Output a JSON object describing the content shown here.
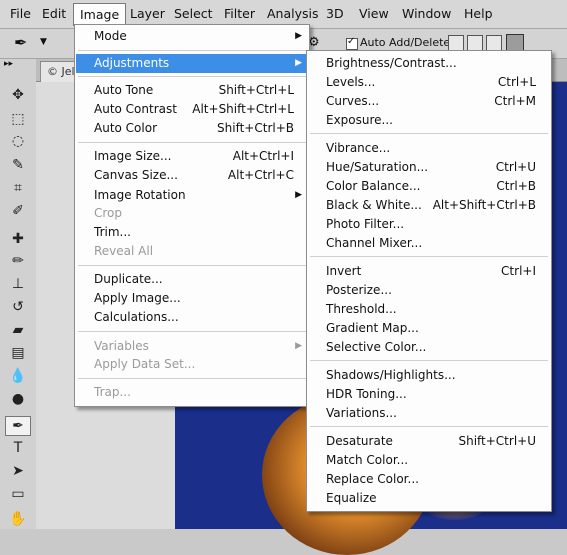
{
  "menubar": {
    "items": [
      "File",
      "Edit",
      "Image",
      "Layer",
      "Select",
      "Filter",
      "Analysis",
      "3D",
      "View",
      "Window",
      "Help"
    ]
  },
  "options": {
    "auto_add_delete": "Auto Add/Delete"
  },
  "document": {
    "tab": "© Jel"
  },
  "image_menu": {
    "mode": "Mode",
    "adjustments": "Adjustments",
    "auto_tone": {
      "label": "Auto Tone",
      "shortcut": "Shift+Ctrl+L"
    },
    "auto_contrast": {
      "label": "Auto Contrast",
      "shortcut": "Alt+Shift+Ctrl+L"
    },
    "auto_color": {
      "label": "Auto Color",
      "shortcut": "Shift+Ctrl+B"
    },
    "image_size": {
      "label": "Image Size...",
      "shortcut": "Alt+Ctrl+I"
    },
    "canvas_size": {
      "label": "Canvas Size...",
      "shortcut": "Alt+Ctrl+C"
    },
    "image_rotation": "Image Rotation",
    "crop": "Crop",
    "trim": "Trim...",
    "reveal_all": "Reveal All",
    "duplicate": "Duplicate...",
    "apply_image": "Apply Image...",
    "calculations": "Calculations...",
    "variables": "Variables",
    "apply_data_set": "Apply Data Set...",
    "trap": "Trap..."
  },
  "adjustments_menu": {
    "brightness_contrast": {
      "label": "Brightness/Contrast...",
      "shortcut": ""
    },
    "levels": {
      "label": "Levels...",
      "shortcut": "Ctrl+L"
    },
    "curves": {
      "label": "Curves...",
      "shortcut": "Ctrl+M"
    },
    "exposure": {
      "label": "Exposure...",
      "shortcut": ""
    },
    "vibrance": {
      "label": "Vibrance...",
      "shortcut": ""
    },
    "hue_saturation": {
      "label": "Hue/Saturation...",
      "shortcut": "Ctrl+U"
    },
    "color_balance": {
      "label": "Color Balance...",
      "shortcut": "Ctrl+B"
    },
    "black_white": {
      "label": "Black & White...",
      "shortcut": "Alt+Shift+Ctrl+B"
    },
    "photo_filter": {
      "label": "Photo Filter...",
      "shortcut": ""
    },
    "channel_mixer": {
      "label": "Channel Mixer...",
      "shortcut": ""
    },
    "invert": {
      "label": "Invert",
      "shortcut": "Ctrl+I"
    },
    "posterize": {
      "label": "Posterize...",
      "shortcut": ""
    },
    "threshold": {
      "label": "Threshold...",
      "shortcut": ""
    },
    "gradient_map": {
      "label": "Gradient Map...",
      "shortcut": ""
    },
    "selective_color": {
      "label": "Selective Color...",
      "shortcut": ""
    },
    "shadows_highlights": {
      "label": "Shadows/Highlights...",
      "shortcut": ""
    },
    "hdr_toning": {
      "label": "HDR Toning...",
      "shortcut": ""
    },
    "variations": {
      "label": "Variations...",
      "shortcut": ""
    },
    "desaturate": {
      "label": "Desaturate",
      "shortcut": "Shift+Ctrl+U"
    },
    "match_color": {
      "label": "Match Color...",
      "shortcut": ""
    },
    "replace_color": {
      "label": "Replace Color...",
      "shortcut": ""
    },
    "equalize": {
      "label": "Equalize",
      "shortcut": ""
    }
  },
  "colors": {
    "highlight": "#3d8ee7",
    "canvas": "#1a2e8a",
    "menu_bg": "#fdfdfd"
  }
}
